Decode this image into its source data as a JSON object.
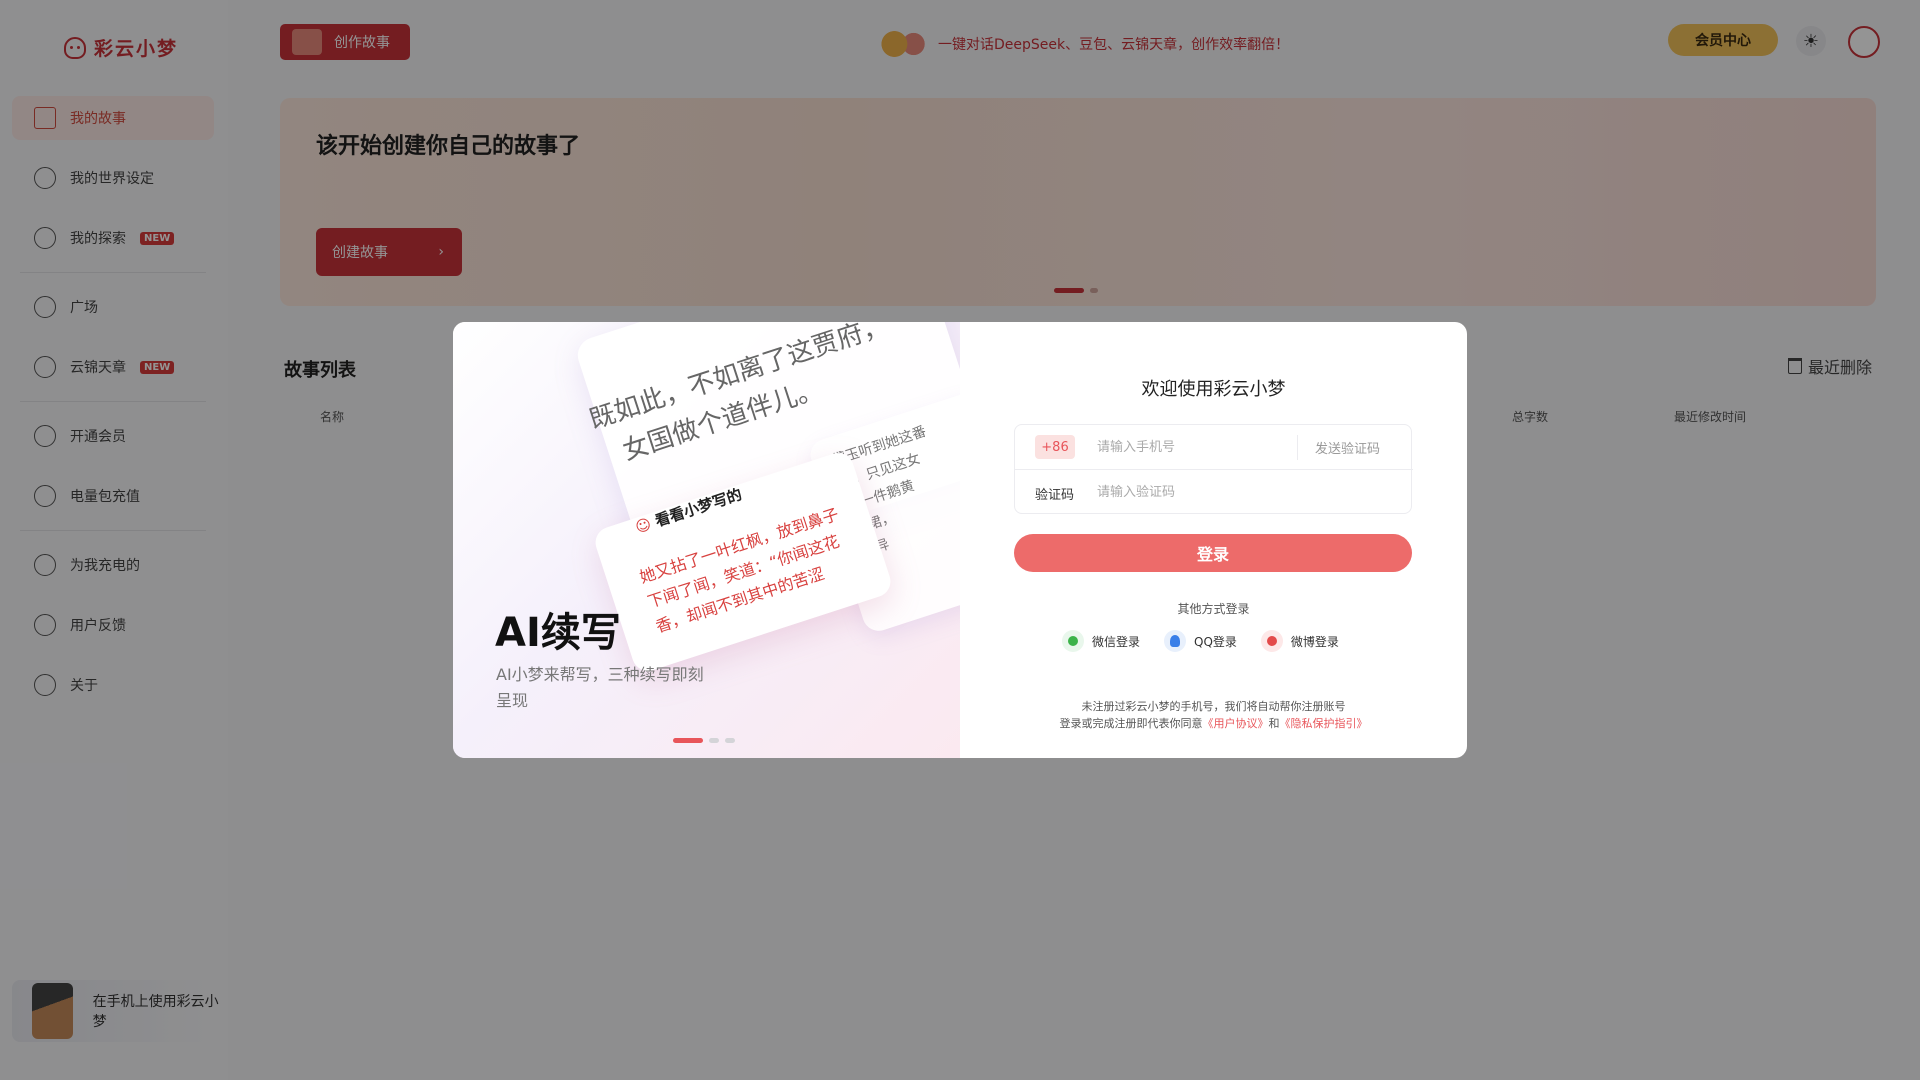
{
  "app": {
    "name": "彩云小梦"
  },
  "header": {
    "create_button": "创作故事",
    "promo": "一键对话DeepSeek、豆包、云锦天章，创作效率翻倍！",
    "vip_button": "会员中心"
  },
  "sidebar": {
    "items": [
      {
        "label": "我的故事",
        "active": true
      },
      {
        "label": "我的世界设定"
      },
      {
        "label": "我的探索",
        "badge": "NEW"
      },
      {
        "label": "广场"
      },
      {
        "label": "云锦天章",
        "badge": "NEW"
      },
      {
        "label": "开通会员"
      },
      {
        "label": "电量包充值"
      },
      {
        "label": "为我充电的"
      },
      {
        "label": "用户反馈"
      },
      {
        "label": "关于"
      }
    ],
    "mobile_promo": "在手机上使用彩云小梦"
  },
  "banner": {
    "title": "该开始创建你自己的故事了",
    "button": "创建故事"
  },
  "story_list": {
    "title": "故事列表",
    "recent_deleted": "最近删除",
    "columns": [
      "名称",
      "总字数",
      "最近修改时间"
    ]
  },
  "modal": {
    "slide": {
      "title": "AI续写",
      "subtitle": "AI小梦来帮写，三种续写即刻呈现",
      "paper_back_line1": "既如此，不如离了这贾府，",
      "paper_back_line2": "女国做个道伴儿。",
      "paper_side_text": "黛玉听到她这番\n定。只见这女\n穿一件鹅黄\n衣裙，\n惊异",
      "card_title": "看看小梦写的",
      "card_text": "她又拈了一叶红枫，放到鼻子下闻了闻，笑道：“你闻这花香，却闻不到其中的苦涩"
    },
    "login": {
      "title": "欢迎使用彩云小梦",
      "country_code": "+86",
      "phone_placeholder": "请输入手机号",
      "send_code": "发送验证码",
      "code_label": "验证码",
      "code_placeholder": "请输入验证码",
      "login_button": "登录",
      "other_methods": "其他方式登录",
      "wechat": "微信登录",
      "qq": "QQ登录",
      "weibo": "微博登录",
      "terms_line1": "未注册过彩云小梦的手机号，我们将自动帮你注册账号",
      "terms_line2_prefix": "登录或完成注册即代表你同意",
      "user_agreement": "《用户协议》",
      "and": "和",
      "privacy_guide": "《隐私保护指引》"
    }
  },
  "colors": {
    "accent": "#c8323a",
    "login_button": "#ed6b6a",
    "vip": "#f1c15a"
  }
}
